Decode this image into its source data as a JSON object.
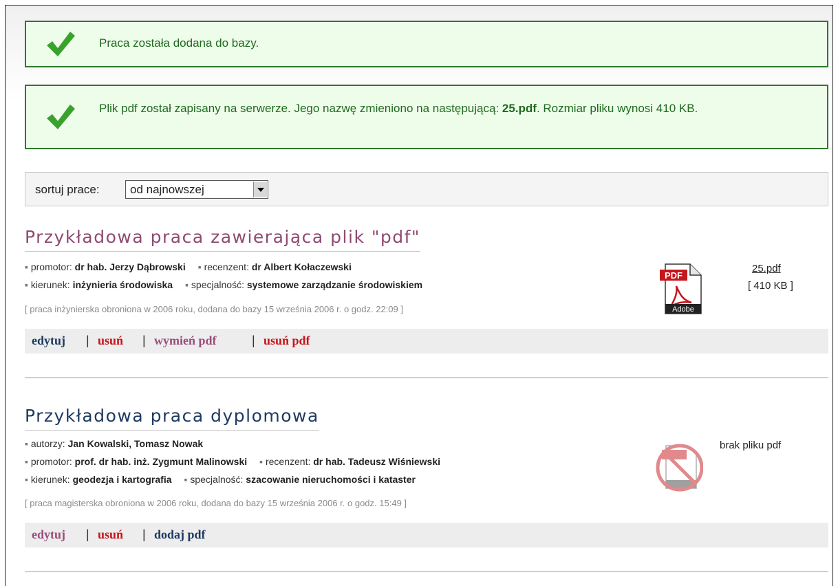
{
  "messages": [
    {
      "icon": "check-icon",
      "text": "Praca została dodana do bazy."
    },
    {
      "icon": "check-icon",
      "text_before": "Plik pdf został zapisany na serwerze. Jego nazwę zmieniono na następującą: ",
      "filename": "25.pdf",
      "text_after": ". Rozmiar pliku wynosi 410 KB."
    }
  ],
  "sort": {
    "label": "sortuj prace:",
    "selected": "od najnowszej"
  },
  "works": [
    {
      "title": "Przykładowa praca zawierająca plik \"pdf\"",
      "promotor_label": "promotor:",
      "promotor": "dr hab. Jerzy Dąbrowski",
      "recenzent_label": "recenzent:",
      "recenzent": "dr Albert Kołaczewski",
      "kierunek_label": "kierunek:",
      "kierunek": "inżynieria środowiska",
      "specjalnosc_label": "specjalność:",
      "specjalnosc": "systemowe zarządzanie środowiskiem",
      "info": "[ praca inżynierska obroniona w 2006 roku, dodana do bazy 15 września 2006 r. o godz. 22:09 ]",
      "file_name": "25.pdf",
      "file_size": "[ 410 KB ]",
      "actions": {
        "edit": "edytuj",
        "delete": "usuń",
        "replace_pdf": "wymień pdf",
        "delete_pdf": "usuń pdf"
      }
    },
    {
      "title": "Przykładowa praca dyplomowa",
      "autorzy_label": "autorzy:",
      "autorzy": "Jan Kowalski, Tomasz Nowak",
      "promotor_label": "promotor:",
      "promotor": "prof. dr hab. inż. Zygmunt Malinowski",
      "recenzent_label": "recenzent:",
      "recenzent": "dr hab. Tadeusz Wiśniewski",
      "kierunek_label": "kierunek:",
      "kierunek": "geodezja i kartografia",
      "specjalnosc_label": "specjalność:",
      "specjalnosc": "szacowanie nieruchomości i kataster",
      "info": "[ praca magisterska obroniona w 2006 roku, dodana do bazy 15 września 2006 r. o godz. 15:49 ]",
      "no_file": "brak pliku pdf",
      "actions": {
        "edit": "edytuj",
        "delete": "usuń",
        "add_pdf": "dodaj pdf"
      }
    }
  ],
  "pdf_icon": {
    "badge": "PDF",
    "brand": "Adobe"
  },
  "bullet": "▪",
  "pipe": "|",
  "colors": {
    "success_border": "#2b7a2b",
    "success_bg": "#eefcea",
    "title1": "#8f4a72",
    "title2": "#1f3a60",
    "delete": "#c4161c"
  }
}
